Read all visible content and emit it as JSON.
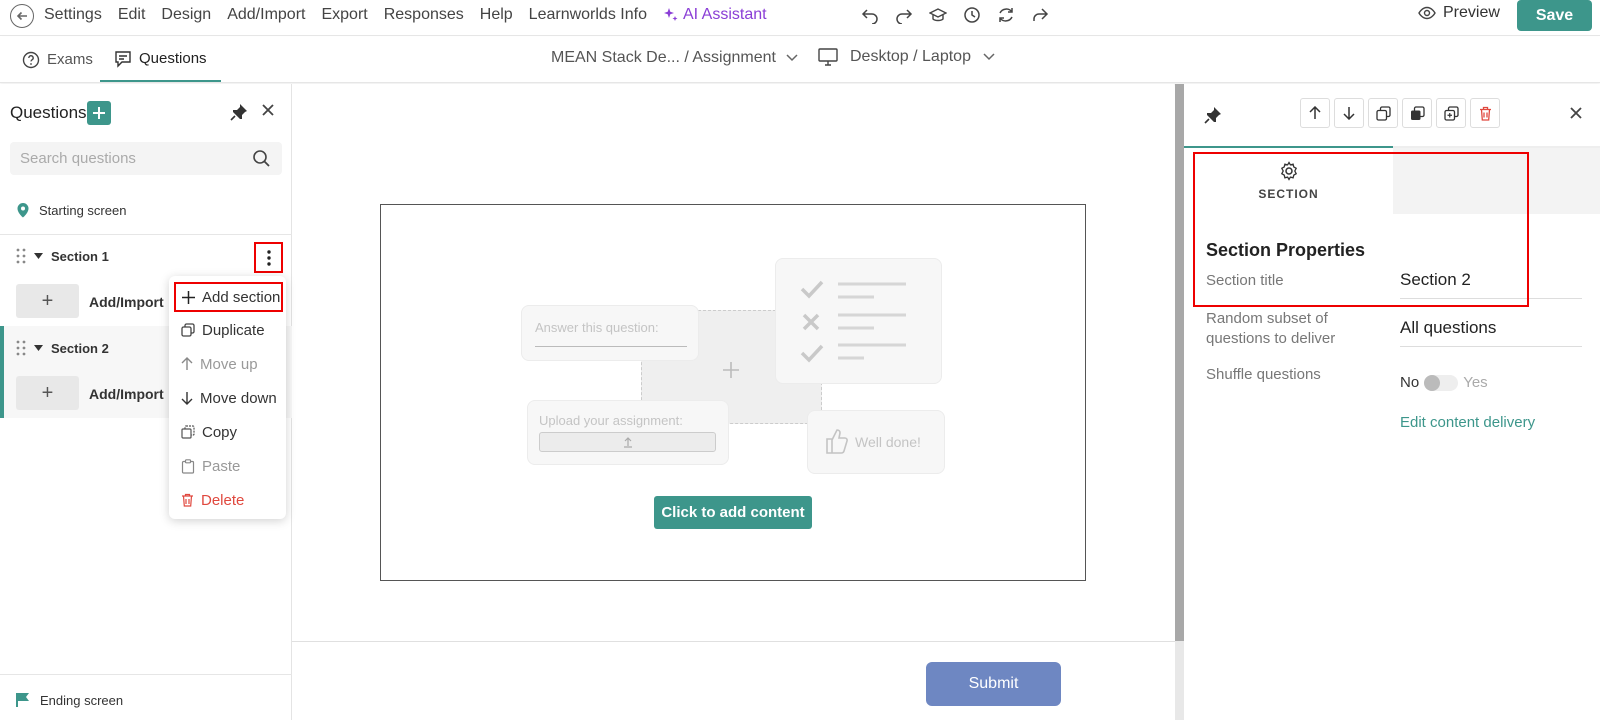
{
  "topbar": {
    "menu": [
      "Settings",
      "Edit",
      "Design",
      "Add/Import",
      "Export",
      "Responses",
      "Help",
      "Learnworlds Info"
    ],
    "ai_label": "AI Assistant",
    "tools": [
      "undo-icon",
      "redo-icon",
      "graduation-cap-icon",
      "clock-icon",
      "refresh-icon",
      "share-icon"
    ],
    "preview_label": "Preview",
    "save_label": "Save"
  },
  "subbar": {
    "tabs": [
      {
        "label": "Exams",
        "icon": "help-circle-icon"
      },
      {
        "label": "Questions",
        "icon": "questions-icon",
        "active": true
      }
    ],
    "breadcrumb": "MEAN Stack De...  / Assignment",
    "device": "Desktop / Laptop"
  },
  "left_panel": {
    "title": "Questions",
    "search_placeholder": "Search questions",
    "starting_screen": "Starting screen",
    "sections": [
      {
        "name": "Section 1",
        "add_label": "Add/Import"
      },
      {
        "name": "Section 2",
        "add_label": "Add/Import"
      }
    ],
    "add_symbol": "+",
    "ending_screen": "Ending screen"
  },
  "context_menu": {
    "items": [
      {
        "label": "Add section",
        "icon": "plus-icon"
      },
      {
        "label": "Duplicate",
        "icon": "duplicate-icon"
      },
      {
        "label": "Move up",
        "icon": "arrow-up-icon"
      },
      {
        "label": "Move down",
        "icon": "arrow-down-icon"
      },
      {
        "label": "Copy",
        "icon": "copy-icon"
      },
      {
        "label": "Paste",
        "icon": "paste-icon"
      },
      {
        "label": "Delete",
        "icon": "trash-icon"
      }
    ]
  },
  "canvas": {
    "answer_placeholder": "Answer this question:",
    "upload_label": "Upload your assignment:",
    "well_done": "Well done!",
    "cta_label": "Click to add content",
    "submit_label": "Submit"
  },
  "right_panel": {
    "tab_label": "SECTION",
    "heading": "Section Properties",
    "fields": {
      "title_label": "Section title",
      "title_value": "Section 2",
      "subset_label": "Random subset of questions to deliver",
      "subset_value": "All questions",
      "shuffle_label": "Shuffle questions",
      "shuffle_no": "No",
      "shuffle_yes": "Yes"
    },
    "link": "Edit content delivery"
  },
  "colors": {
    "accent": "#3d968b",
    "ai": "#8a3ed6",
    "submit": "#6e87c2",
    "highlight": "#e00000",
    "danger": "#e0483e"
  }
}
